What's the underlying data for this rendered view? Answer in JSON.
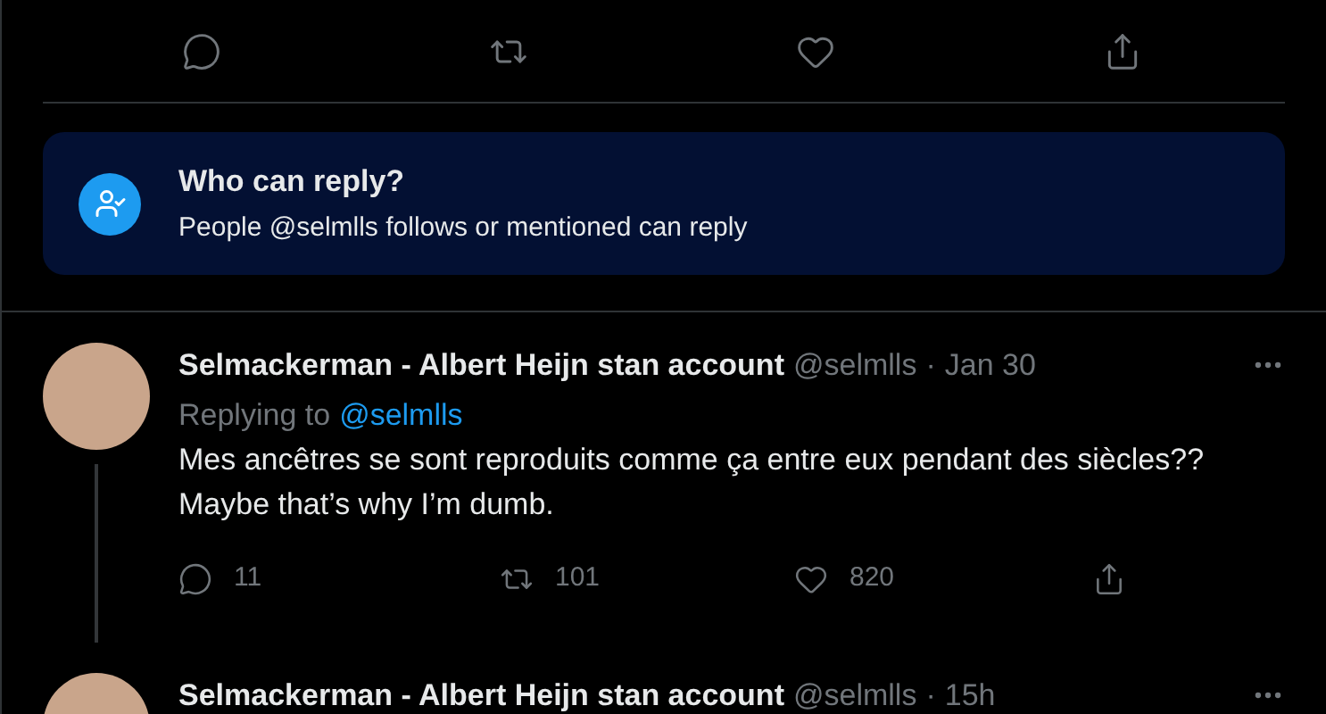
{
  "who_can_reply": {
    "title": "Who can reply?",
    "text": "People @selmlls follows or mentioned can reply"
  },
  "replies": [
    {
      "name": "Selmackerman - Albert Heijn stan account",
      "handle": "@selmlls",
      "separator": "·",
      "time": "Jan 30",
      "replying_label": "Replying to",
      "replying_to": "@selmlls",
      "text": [
        "Mes ancêtres se sont reproduits comme ça entre eux pendant des siècles??",
        "Maybe that’s why I’m dumb."
      ],
      "replies": "11",
      "retweets": "101",
      "likes": "820",
      "thread": true
    },
    {
      "name": "Selmackerman - Albert Heijn stan account",
      "handle": "@selmlls",
      "separator": "·",
      "time": "15h",
      "thread": false
    }
  ]
}
